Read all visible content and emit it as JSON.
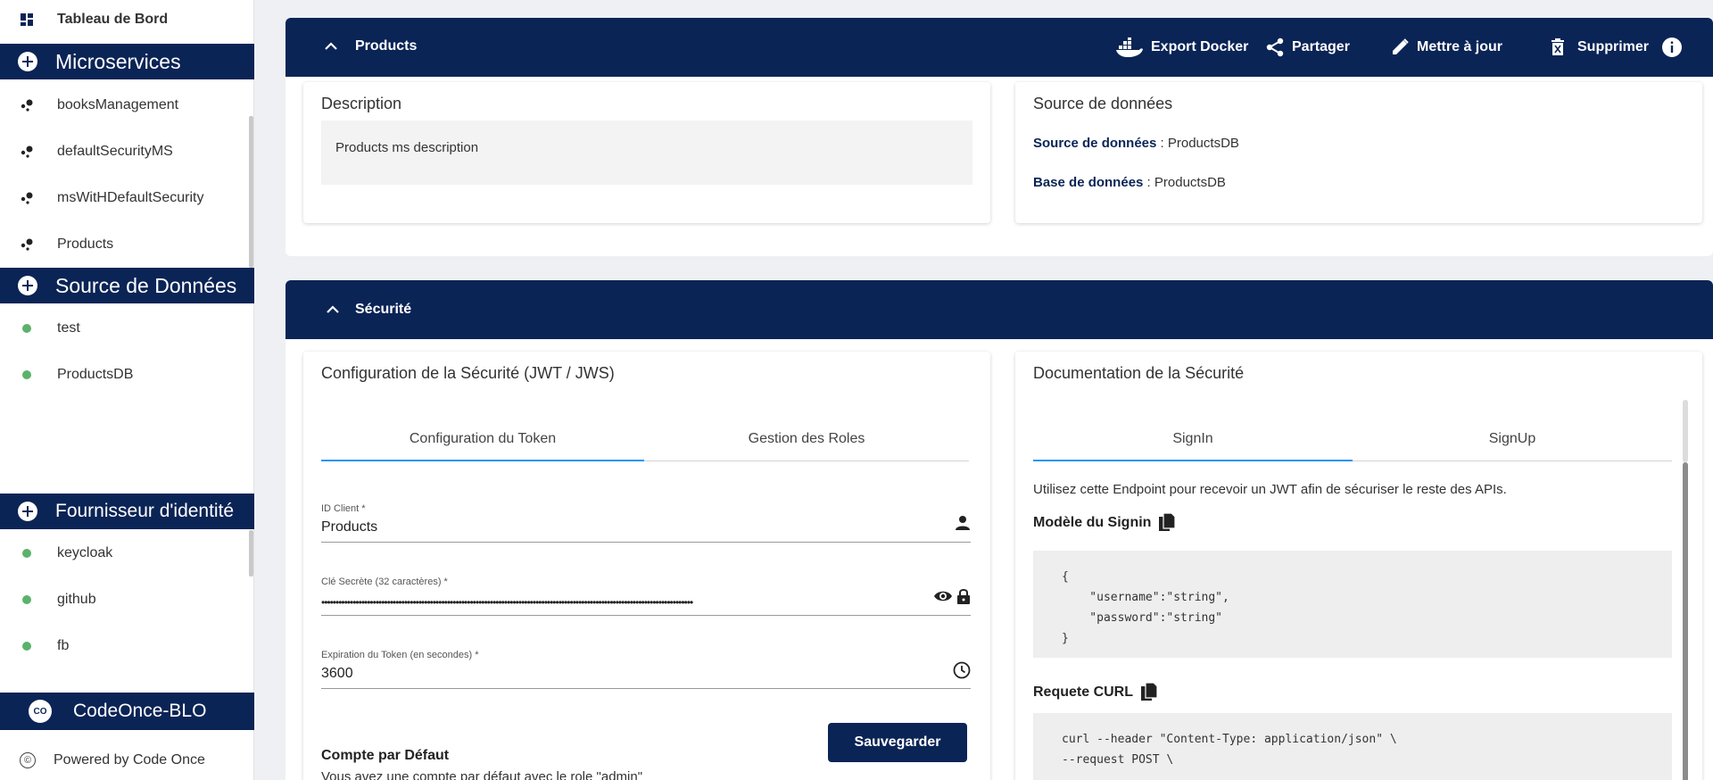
{
  "sidebar": {
    "dashboard": "Tableau de Bord",
    "sections": [
      {
        "label": "Microservices",
        "items": [
          "booksManagement",
          "defaultSecurityMS",
          "msWitHDefaultSecurity",
          "Products"
        ]
      },
      {
        "label": "Source de Données",
        "items": [
          "test",
          "ProductsDB"
        ]
      },
      {
        "label": "Fournisseur d'identité",
        "items": [
          "keycloak",
          "github",
          "fb"
        ]
      }
    ],
    "brand_logo": "CO",
    "brand": "CodeOnce-BLO",
    "footer_symbol": "©",
    "footer": "Powered by Code Once"
  },
  "products_panel": {
    "title": "Products",
    "actions": {
      "export": "Export Docker",
      "share": "Partager",
      "update": "Mettre à jour",
      "delete": "Supprimer"
    },
    "description": {
      "title": "Description",
      "text": "Products ms description"
    },
    "datasource": {
      "title": "Source de données",
      "rows": [
        {
          "key": "Source de données",
          "value": " : ProductsDB"
        },
        {
          "key": "Base de données",
          "value": " : ProductsDB"
        }
      ]
    }
  },
  "security_panel": {
    "title": "Sécurité",
    "config": {
      "title": "Configuration de la Sécurité (JWT / JWS)",
      "tabs": [
        "Configuration du Token",
        "Gestion des Roles"
      ],
      "fields": {
        "client_id": {
          "label": "ID Client *",
          "value": "Products"
        },
        "secret": {
          "label": "Clé Secrète (32 caractères) *",
          "value": "••••••••••••••••••••••••••••••••••••••••••••••••••••••••••••••••••••••••••••••••••••••••••••••••••••••••••••••••••••••••••••••••••"
        },
        "expiration": {
          "label": "Expiration du Token (en secondes) *",
          "value": "3600"
        }
      },
      "save": "Sauvegarder",
      "default_account_title": "Compte par Défaut",
      "default_account_text": "Vous avez une compte par défaut avec le role \"admin\""
    },
    "docs": {
      "title": "Documentation de la Sécurité",
      "tabs": [
        "SignIn",
        "SignUp"
      ],
      "intro": "Utilisez cette Endpoint pour recevoir un JWT afin de sécuriser le reste des APIs.",
      "signin_model_title": "Modèle du Signin",
      "signin_model_code": "{\n    \"username\":\"string\",\n    \"password\":\"string\"\n}",
      "curl_title": "Requete CURL",
      "curl_code": "curl --header \"Content-Type: application/json\" \\\n--request POST \\"
    }
  },
  "colors": {
    "primary": "#0b2456",
    "accent": "#2196f3",
    "status_dot": "#5bb26a"
  }
}
